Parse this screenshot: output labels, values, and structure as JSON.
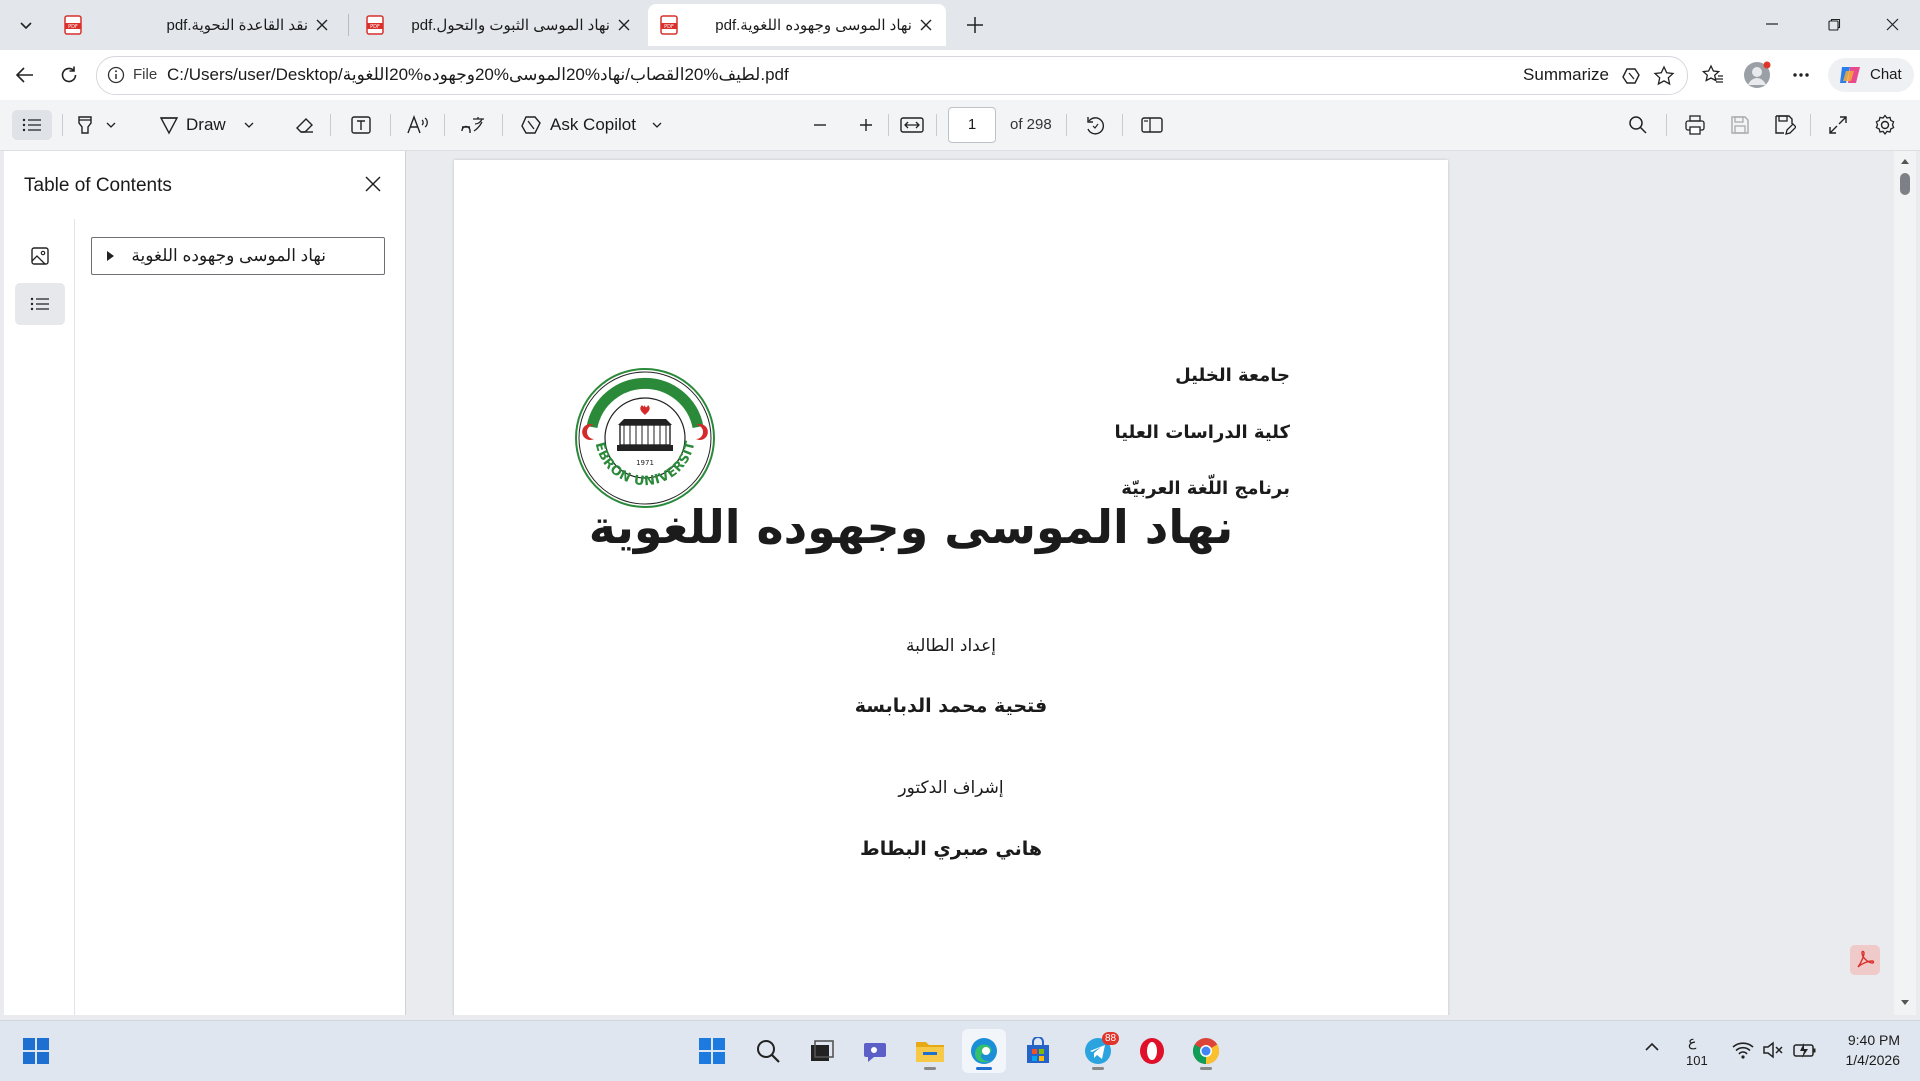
{
  "tabs": [
    {
      "title": "نقد القاعدة النحوية.pdf",
      "active": false
    },
    {
      "title": "نهاد الموسى الثبوت والتحول.pdf",
      "active": false
    },
    {
      "title": "نهاد الموسى وجهوده اللغوية.pdf",
      "active": true
    }
  ],
  "address": {
    "file_label": "File",
    "url": "C:/Users/user/Desktop/لطيف%20القصاب/نهاد%20الموسى%20وجهوده%20اللغوية.pdf",
    "summarize_label": "Summarize"
  },
  "chat_label": "Chat",
  "pdf_toolbar": {
    "draw_label": "Draw",
    "ask_copilot_label": "Ask Copilot",
    "current_page": "1",
    "page_count_label": "of 298"
  },
  "sidebar": {
    "title": "Table of Contents",
    "toc_items": [
      {
        "label": "نهاد الموسى وجهوده اللغوية"
      }
    ]
  },
  "document": {
    "header_lines": [
      "جامعة الخليل",
      "كلية الدراسات العليا",
      "برنامج اللّغة العربيّة"
    ],
    "title": "نهاد الموسى وجهوده اللغوية",
    "prepared_by_label": "إعداد الطالبة",
    "student_name": "فتحية محمد الدبابسة",
    "supervisor_label": "إشراف الدكتور",
    "supervisor_name": "هاني صبري البطاط",
    "seal": {
      "text": "HEBRON UNIVERSITY",
      "year": "1971"
    }
  },
  "taskbar": {
    "apps": [
      "start-icon",
      "search-icon",
      "task-view-icon",
      "teams-icon",
      "file-explorer-icon",
      "edge-icon",
      "store-icon",
      "telegram-icon",
      "opera-icon",
      "chrome-icon"
    ],
    "telegram_badge": "88",
    "language": "ع",
    "language_code": "101",
    "time": "9:40 PM",
    "date": "1/4/2026"
  },
  "colors": {
    "accent": "#1d6fd1",
    "pdf_red": "#d9302c",
    "seal_green": "#2a8a3a",
    "seal_red": "#d42a2a"
  }
}
